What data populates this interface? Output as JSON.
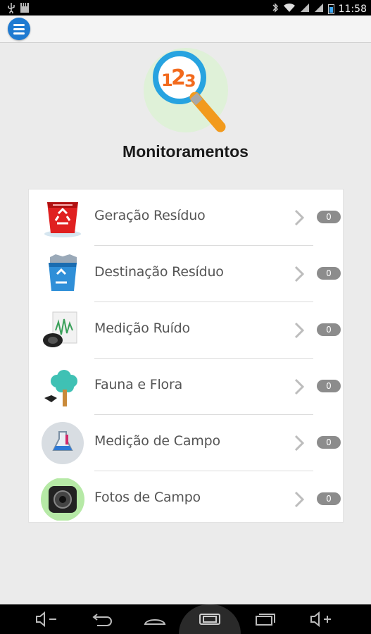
{
  "status_bar": {
    "time": "11:58"
  },
  "page": {
    "title": "Monitoramentos"
  },
  "list": {
    "items": [
      {
        "label": "Geração Resíduo",
        "count": "0",
        "icon": "red-recycle-bin-icon"
      },
      {
        "label": "Destinação Resíduo",
        "count": "0",
        "icon": "blue-recycle-bin-icon"
      },
      {
        "label": "Medição Ruído",
        "count": "0",
        "icon": "noise-chart-speaker-icon"
      },
      {
        "label": "Fauna e Flora",
        "count": "0",
        "icon": "tree-bird-icon"
      },
      {
        "label": "Medição de Campo",
        "count": "0",
        "icon": "flask-icon"
      },
      {
        "label": "Fotos de Campo",
        "count": "0",
        "icon": "camera-lens-icon"
      }
    ]
  },
  "colors": {
    "accent_blue": "#1f7ad1",
    "badge_gray": "#8c8c8c",
    "magnifier_orange": "#f29a1d"
  }
}
